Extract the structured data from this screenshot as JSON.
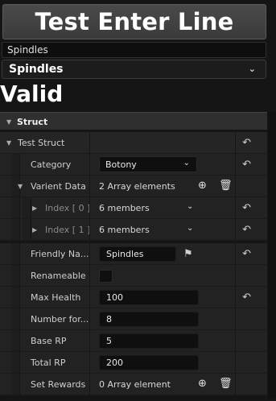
{
  "header": {
    "button_label": "Test Enter Line",
    "text_input_value": "Spindles",
    "combo_value": "Spindles",
    "valid_label": "Valid"
  },
  "panel": {
    "section_title": "Struct",
    "struct_name": "Test Struct",
    "category": {
      "label": "Category",
      "value": "Botony"
    },
    "varient": {
      "label": "Varient Data",
      "value": "2 Array elements"
    },
    "index0": {
      "label": "Index [ 0 ]",
      "value": "6 members"
    },
    "index1": {
      "label": "Index [ 1 ]",
      "value": "6 members"
    },
    "friendly": {
      "label": "Friendly Na...",
      "value": "Spindles"
    },
    "renameable": {
      "label": "Renameable",
      "checked": false
    },
    "max_health": {
      "label": "Max Health",
      "value": "100"
    },
    "number_for": {
      "label": "Number for...",
      "value": "8"
    },
    "base_rp": {
      "label": "Base RP",
      "value": "5"
    },
    "total_rp": {
      "label": "Total RP",
      "value": "200"
    },
    "set_rewards": {
      "label": "Set Rewards",
      "value": "0 Array element"
    }
  },
  "icons": {
    "reset": "reset-arrow-icon",
    "add": "plus-circle-icon",
    "delete": "trash-icon",
    "expand": "triangle-icon",
    "dropdown": "chevron-down-icon",
    "flag": "flag-icon"
  },
  "colors": {
    "background": "#151515",
    "row": "#252525",
    "field": "#0f0f0f",
    "text": "#d6d6d6"
  }
}
